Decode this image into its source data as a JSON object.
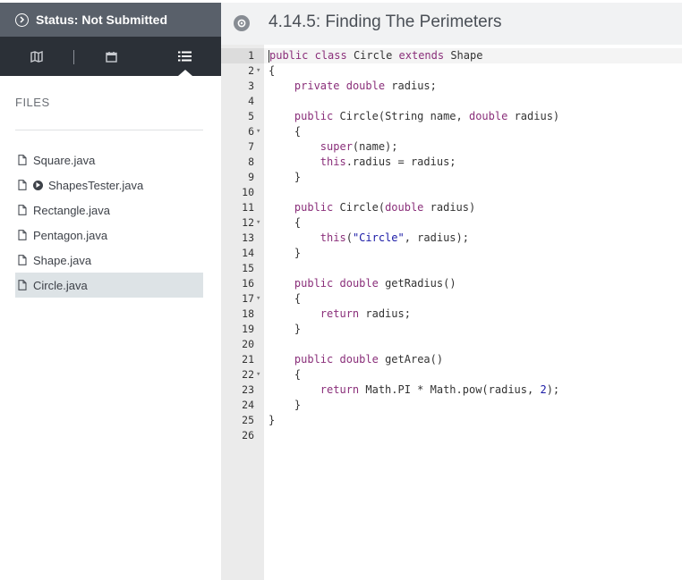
{
  "status": {
    "label": "Status: Not Submitted"
  },
  "sidebar": {
    "nav_icons": [
      "map-icon",
      "calendar-icon",
      "list-icon"
    ],
    "files_title": "FILES",
    "files": [
      {
        "name": "Square.java",
        "runnable": false,
        "active": false
      },
      {
        "name": "ShapesTester.java",
        "runnable": true,
        "active": false
      },
      {
        "name": "Rectangle.java",
        "runnable": false,
        "active": false
      },
      {
        "name": "Pentagon.java",
        "runnable": false,
        "active": false
      },
      {
        "name": "Shape.java",
        "runnable": false,
        "active": false
      },
      {
        "name": "Circle.java",
        "runnable": false,
        "active": true
      }
    ]
  },
  "header": {
    "title": "4.14.5: Finding The Perimeters",
    "icon": "gear-icon"
  },
  "editor": {
    "lines": [
      {
        "n": "1",
        "fold": false,
        "tokens": [
          [
            "kw",
            "public"
          ],
          [
            "t",
            " "
          ],
          [
            "kw",
            "class"
          ],
          [
            "t",
            " Circle "
          ],
          [
            "kw",
            "extends"
          ],
          [
            "t",
            " Shape"
          ]
        ]
      },
      {
        "n": "2",
        "fold": true,
        "tokens": [
          [
            "t",
            "{"
          ]
        ]
      },
      {
        "n": "3",
        "fold": false,
        "tokens": [
          [
            "t",
            "    "
          ],
          [
            "kw",
            "private"
          ],
          [
            "t",
            " "
          ],
          [
            "kw",
            "double"
          ],
          [
            "t",
            " radius;"
          ]
        ]
      },
      {
        "n": "4",
        "fold": false,
        "tokens": []
      },
      {
        "n": "5",
        "fold": false,
        "tokens": [
          [
            "t",
            "    "
          ],
          [
            "kw",
            "public"
          ],
          [
            "t",
            " Circle(String name, "
          ],
          [
            "kw",
            "double"
          ],
          [
            "t",
            " radius)"
          ]
        ]
      },
      {
        "n": "6",
        "fold": true,
        "tokens": [
          [
            "t",
            "    {"
          ]
        ]
      },
      {
        "n": "7",
        "fold": false,
        "tokens": [
          [
            "t",
            "        "
          ],
          [
            "kw",
            "super"
          ],
          [
            "t",
            "(name);"
          ]
        ]
      },
      {
        "n": "8",
        "fold": false,
        "tokens": [
          [
            "t",
            "        "
          ],
          [
            "kw",
            "this"
          ],
          [
            "t",
            ".radius = radius;"
          ]
        ]
      },
      {
        "n": "9",
        "fold": false,
        "tokens": [
          [
            "t",
            "    }"
          ]
        ]
      },
      {
        "n": "10",
        "fold": false,
        "tokens": []
      },
      {
        "n": "11",
        "fold": false,
        "tokens": [
          [
            "t",
            "    "
          ],
          [
            "kw",
            "public"
          ],
          [
            "t",
            " Circle("
          ],
          [
            "kw",
            "double"
          ],
          [
            "t",
            " radius)"
          ]
        ]
      },
      {
        "n": "12",
        "fold": true,
        "tokens": [
          [
            "t",
            "    {"
          ]
        ]
      },
      {
        "n": "13",
        "fold": false,
        "tokens": [
          [
            "t",
            "        "
          ],
          [
            "kw",
            "this"
          ],
          [
            "t",
            "("
          ],
          [
            "str",
            "\"Circle\""
          ],
          [
            "t",
            ", radius);"
          ]
        ]
      },
      {
        "n": "14",
        "fold": false,
        "tokens": [
          [
            "t",
            "    }"
          ]
        ]
      },
      {
        "n": "15",
        "fold": false,
        "tokens": []
      },
      {
        "n": "16",
        "fold": false,
        "tokens": [
          [
            "t",
            "    "
          ],
          [
            "kw",
            "public"
          ],
          [
            "t",
            " "
          ],
          [
            "kw",
            "double"
          ],
          [
            "t",
            " getRadius()"
          ]
        ]
      },
      {
        "n": "17",
        "fold": true,
        "tokens": [
          [
            "t",
            "    {"
          ]
        ]
      },
      {
        "n": "18",
        "fold": false,
        "tokens": [
          [
            "t",
            "        "
          ],
          [
            "kw",
            "return"
          ],
          [
            "t",
            " radius;"
          ]
        ]
      },
      {
        "n": "19",
        "fold": false,
        "tokens": [
          [
            "t",
            "    }"
          ]
        ]
      },
      {
        "n": "20",
        "fold": false,
        "tokens": []
      },
      {
        "n": "21",
        "fold": false,
        "tokens": [
          [
            "t",
            "    "
          ],
          [
            "kw",
            "public"
          ],
          [
            "t",
            " "
          ],
          [
            "kw",
            "double"
          ],
          [
            "t",
            " getArea()"
          ]
        ]
      },
      {
        "n": "22",
        "fold": true,
        "tokens": [
          [
            "t",
            "    {"
          ]
        ]
      },
      {
        "n": "23",
        "fold": false,
        "tokens": [
          [
            "t",
            "        "
          ],
          [
            "kw",
            "return"
          ],
          [
            "t",
            " Math.PI * Math.pow(radius, "
          ],
          [
            "num",
            "2"
          ],
          [
            "t",
            ");"
          ]
        ]
      },
      {
        "n": "24",
        "fold": false,
        "tokens": [
          [
            "t",
            "    }"
          ]
        ]
      },
      {
        "n": "25",
        "fold": false,
        "tokens": [
          [
            "t",
            "}"
          ]
        ]
      },
      {
        "n": "26",
        "fold": false,
        "tokens": []
      }
    ]
  }
}
